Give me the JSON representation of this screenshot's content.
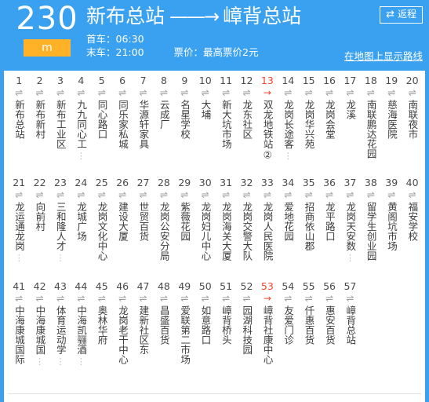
{
  "header": {
    "route_number": "230",
    "mode_badge": "m",
    "origin": "新布总站",
    "arrow": "——→",
    "destination": "嶂背总站",
    "first_bus_label": "首车：06:30",
    "last_bus_label": "末车：21:00",
    "fare_label": "票价：最高票价2元",
    "return_button_label": "返程",
    "return_button_icon": "swap-horizontal-icon",
    "map_link_label": "在地图上显示路线",
    "header_color": "#39a1f0",
    "badge_color": "#ffb127"
  },
  "board": {
    "transfer_icon": "⇌",
    "terminus_icon": "→",
    "truncation_mark": "⋮",
    "highlight_color": "#f4442e",
    "rows": [
      [
        {
          "num": "1",
          "name": "新布总站",
          "icon": "transfer-arrows-icon",
          "highlight": false,
          "truncated": false
        },
        {
          "num": "2",
          "name": "新布新村",
          "icon": "transfer-arrows-icon",
          "highlight": false,
          "truncated": false
        },
        {
          "num": "3",
          "name": "新布工业区",
          "icon": "transfer-arrows-icon",
          "highlight": false,
          "truncated": false
        },
        {
          "num": "4",
          "name": "九九同心工",
          "icon": "transfer-arrows-icon",
          "highlight": false,
          "truncated": true
        },
        {
          "num": "5",
          "name": "同心路口",
          "icon": "transfer-arrows-icon",
          "highlight": false,
          "truncated": false
        },
        {
          "num": "6",
          "name": "同乐家私城",
          "icon": "transfer-arrows-icon",
          "highlight": false,
          "truncated": false
        },
        {
          "num": "7",
          "name": "华源轩家具",
          "icon": "transfer-arrows-icon",
          "highlight": false,
          "truncated": false
        },
        {
          "num": "8",
          "name": "云成厂",
          "icon": "transfer-arrows-icon",
          "highlight": false,
          "truncated": false
        },
        {
          "num": "9",
          "name": "名星学校",
          "icon": "transfer-arrows-icon",
          "highlight": false,
          "truncated": false
        },
        {
          "num": "10",
          "name": "大埔",
          "icon": "transfer-arrows-icon",
          "highlight": false,
          "truncated": false
        },
        {
          "num": "11",
          "name": "新大坑市场",
          "icon": "transfer-arrows-icon",
          "highlight": false,
          "truncated": false
        },
        {
          "num": "12",
          "name": "龙东社区",
          "icon": "transfer-arrows-icon",
          "highlight": false,
          "truncated": false
        },
        {
          "num": "13",
          "name": "双龙地铁站②",
          "icon": "terminus-arrow-icon",
          "highlight": true,
          "truncated": false
        },
        {
          "num": "14",
          "name": "龙岗长途客",
          "icon": "transfer-arrows-icon",
          "highlight": false,
          "truncated": true
        },
        {
          "num": "15",
          "name": "龙岗华兴苑",
          "icon": "transfer-arrows-icon",
          "highlight": false,
          "truncated": false
        },
        {
          "num": "16",
          "name": "龙岗会堂",
          "icon": "transfer-arrows-icon",
          "highlight": false,
          "truncated": false
        },
        {
          "num": "17",
          "name": "龙溪",
          "icon": "transfer-arrows-icon",
          "highlight": false,
          "truncated": false
        },
        {
          "num": "18",
          "name": "南联鹏达花园",
          "icon": "transfer-arrows-icon",
          "highlight": false,
          "truncated": false
        },
        {
          "num": "19",
          "name": "慈海医院",
          "icon": "transfer-arrows-icon",
          "highlight": false,
          "truncated": false
        },
        {
          "num": "20",
          "name": "南联夜市",
          "icon": "transfer-arrows-icon",
          "highlight": false,
          "truncated": false
        }
      ],
      [
        {
          "num": "21",
          "name": "龙运通龙岗",
          "icon": "transfer-arrows-icon",
          "highlight": false,
          "truncated": true
        },
        {
          "num": "22",
          "name": "向前村",
          "icon": "transfer-arrows-icon",
          "highlight": false,
          "truncated": false
        },
        {
          "num": "23",
          "name": "三和隆人才",
          "icon": "transfer-arrows-icon",
          "highlight": false,
          "truncated": true
        },
        {
          "num": "24",
          "name": "龙城广场",
          "icon": "transfer-arrows-icon",
          "highlight": false,
          "truncated": false
        },
        {
          "num": "25",
          "name": "龙岗文化中心",
          "icon": "transfer-arrows-icon",
          "highlight": false,
          "truncated": false
        },
        {
          "num": "26",
          "name": "建设大厦",
          "icon": "transfer-arrows-icon",
          "highlight": false,
          "truncated": false
        },
        {
          "num": "27",
          "name": "世贸百货",
          "icon": "transfer-arrows-icon",
          "highlight": false,
          "truncated": false
        },
        {
          "num": "28",
          "name": "龙岗公安分局",
          "icon": "transfer-arrows-icon",
          "highlight": false,
          "truncated": false
        },
        {
          "num": "29",
          "name": "紫薇花园",
          "icon": "transfer-arrows-icon",
          "highlight": false,
          "truncated": false
        },
        {
          "num": "30",
          "name": "龙岗妇儿中心",
          "icon": "transfer-arrows-icon",
          "highlight": false,
          "truncated": false
        },
        {
          "num": "31",
          "name": "龙岗海关大厦",
          "icon": "transfer-arrows-icon",
          "highlight": false,
          "truncated": false
        },
        {
          "num": "32",
          "name": "龙岗交警大队",
          "icon": "transfer-arrows-icon",
          "highlight": false,
          "truncated": false
        },
        {
          "num": "33",
          "name": "龙岗人民医院",
          "icon": "transfer-arrows-icon",
          "highlight": false,
          "truncated": false
        },
        {
          "num": "34",
          "name": "爱地花园",
          "icon": "transfer-arrows-icon",
          "highlight": false,
          "truncated": false
        },
        {
          "num": "35",
          "name": "招商依山郡",
          "icon": "transfer-arrows-icon",
          "highlight": false,
          "truncated": false
        },
        {
          "num": "36",
          "name": "龙平路口",
          "icon": "transfer-arrows-icon",
          "highlight": false,
          "truncated": false
        },
        {
          "num": "37",
          "name": "龙岗天安数",
          "icon": "transfer-arrows-icon",
          "highlight": false,
          "truncated": true
        },
        {
          "num": "38",
          "name": "留学生创业园",
          "icon": "transfer-arrows-icon",
          "highlight": false,
          "truncated": false
        },
        {
          "num": "39",
          "name": "黄阁坑市场",
          "icon": "transfer-arrows-icon",
          "highlight": false,
          "truncated": false
        },
        {
          "num": "40",
          "name": "福安学校",
          "icon": "transfer-arrows-icon",
          "highlight": false,
          "truncated": false
        }
      ],
      [
        {
          "num": "41",
          "name": "中海康城国际",
          "icon": "transfer-arrows-icon",
          "highlight": false,
          "truncated": false
        },
        {
          "num": "42",
          "name": "中海康城国",
          "icon": "transfer-arrows-icon",
          "highlight": false,
          "truncated": true
        },
        {
          "num": "43",
          "name": "体育运动学",
          "icon": "transfer-arrows-icon",
          "highlight": false,
          "truncated": true
        },
        {
          "num": "44",
          "name": "中海凯骊酒",
          "icon": "transfer-arrows-icon",
          "highlight": false,
          "truncated": true
        },
        {
          "num": "45",
          "name": "奥林华府",
          "icon": "transfer-arrows-icon",
          "highlight": false,
          "truncated": false
        },
        {
          "num": "46",
          "name": "龙岗老干中心",
          "icon": "transfer-arrows-icon",
          "highlight": false,
          "truncated": false
        },
        {
          "num": "47",
          "name": "建新社区东",
          "icon": "transfer-arrows-icon",
          "highlight": false,
          "truncated": false
        },
        {
          "num": "48",
          "name": "昌盛百货",
          "icon": "transfer-arrows-icon",
          "highlight": false,
          "truncated": false
        },
        {
          "num": "49",
          "name": "爱联第二市场",
          "icon": "transfer-arrows-icon",
          "highlight": false,
          "truncated": false
        },
        {
          "num": "50",
          "name": "如意路口",
          "icon": "transfer-arrows-icon",
          "highlight": false,
          "truncated": false
        },
        {
          "num": "51",
          "name": "嶂背桥头",
          "icon": "transfer-arrows-icon",
          "highlight": false,
          "truncated": false
        },
        {
          "num": "52",
          "name": "园湖科技园",
          "icon": "transfer-arrows-icon",
          "highlight": false,
          "truncated": false
        },
        {
          "num": "53",
          "name": "嶂背社康中心",
          "icon": "terminus-arrow-icon",
          "highlight": true,
          "truncated": false
        },
        {
          "num": "54",
          "name": "友爱门诊",
          "icon": "transfer-arrows-icon",
          "highlight": false,
          "truncated": false
        },
        {
          "num": "55",
          "name": "仟惠百货",
          "icon": "transfer-arrows-icon",
          "highlight": false,
          "truncated": false
        },
        {
          "num": "56",
          "name": "惠安百货",
          "icon": "transfer-arrows-icon",
          "highlight": false,
          "truncated": false
        },
        {
          "num": "57",
          "name": "嶂背总站",
          "icon": "transfer-arrows-icon",
          "highlight": false,
          "truncated": false
        }
      ]
    ]
  }
}
